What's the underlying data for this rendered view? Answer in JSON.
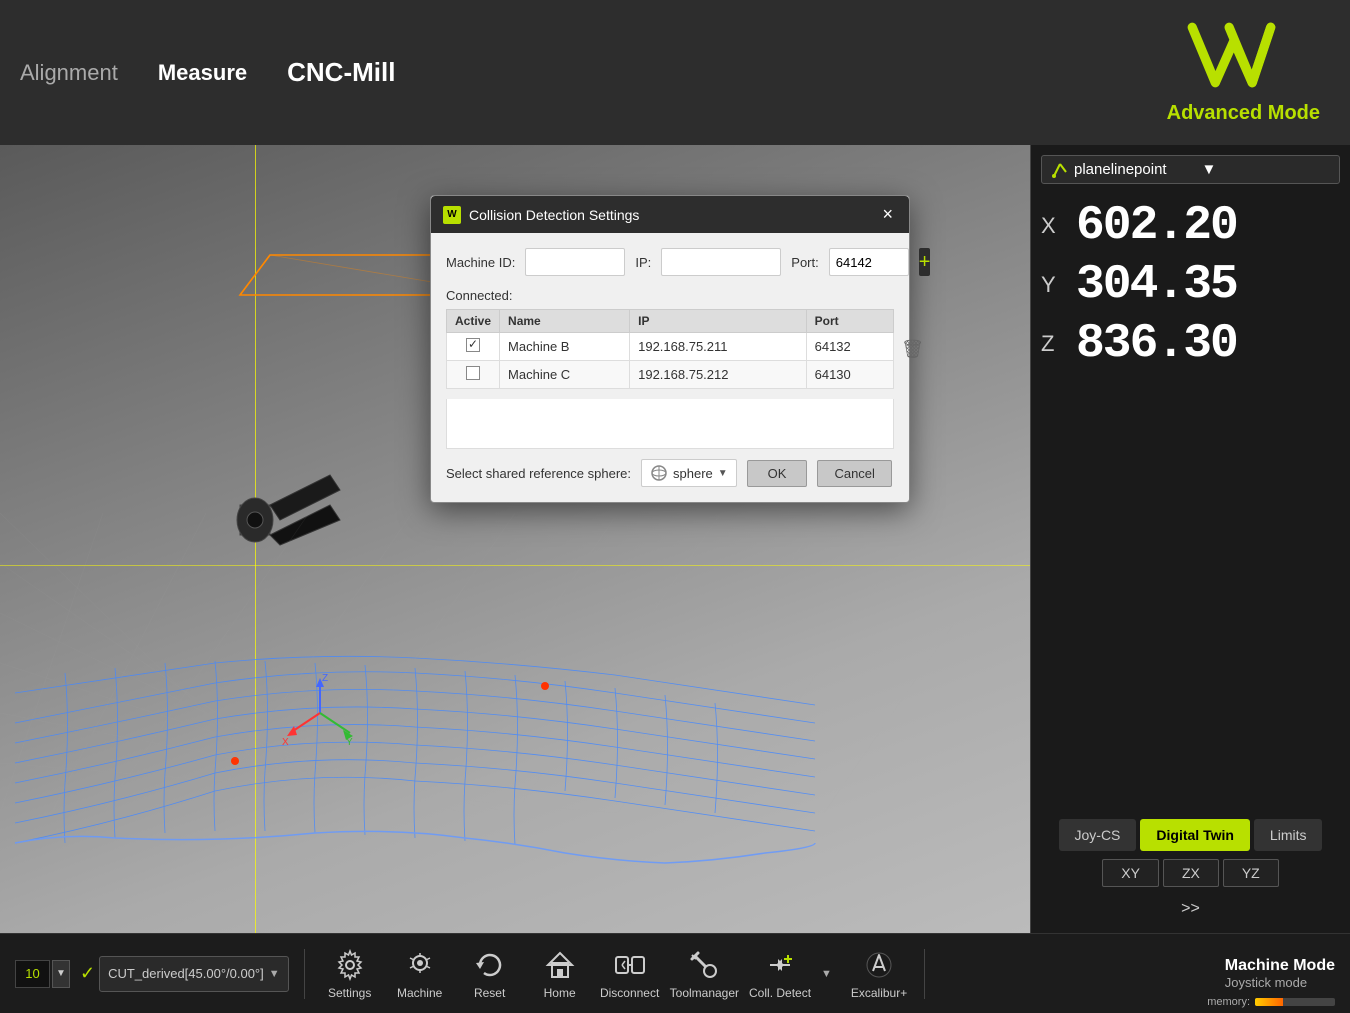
{
  "topbar": {
    "nav_alignment": "Alignment",
    "nav_measure": "Measure",
    "nav_cnc": "CNC-Mill",
    "advanced_mode": "Advanced Mode"
  },
  "rightpanel": {
    "dropdown_value": "planelinepoint",
    "x_label": "X",
    "x_value": "602.20",
    "y_label": "Y",
    "y_value": "304.35",
    "z_label": "Z",
    "z_value": "836.30",
    "btn_joycs": "Joy-CS",
    "btn_digital_twin": "Digital Twin",
    "btn_limits": "Limits",
    "axis_xy": "XY",
    "axis_zx": "ZX",
    "axis_yz": "YZ",
    "chevron": ">>"
  },
  "dialog": {
    "title": "Collision Detection Settings",
    "machine_id_label": "Machine ID:",
    "ip_label": "IP:",
    "port_label": "Port:",
    "port_value": "64142",
    "machine_id_value": "",
    "ip_value": "",
    "connected_label": "Connected:",
    "table_headers": [
      "Active",
      "Name",
      "IP",
      "Port"
    ],
    "table_rows": [
      {
        "active": true,
        "name": "Machine B",
        "ip": "192.168.75.211",
        "port": "64132"
      },
      {
        "active": false,
        "name": "Machine C",
        "ip": "192.168.75.212",
        "port": "64130"
      }
    ],
    "ref_sphere_label": "Select shared reference sphere:",
    "sphere_value": "sphere",
    "ok_label": "OK",
    "cancel_label": "Cancel",
    "close_icon": "×"
  },
  "bottombar": {
    "cut_derived": "CUT_derived[45.00°/0.00°]",
    "settings_label": "Settings",
    "machine_label": "Machine",
    "reset_label": "Reset",
    "home_label": "Home",
    "disconnect_label": "Disconnect",
    "toolmanager_label": "Toolmanager",
    "coll_detect_label": "Coll. Detect",
    "excalibur_label": "Excalibur+",
    "machine_mode_title": "Machine Mode",
    "joystick_mode": "Joystick mode",
    "memory_label": "memory:"
  }
}
